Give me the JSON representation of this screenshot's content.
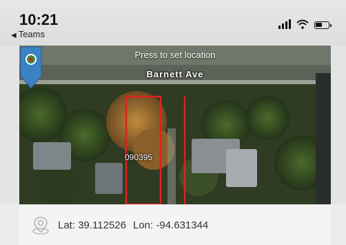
{
  "status_bar": {
    "time": "10:21",
    "back_label": "Teams",
    "icons": [
      "signal-icon",
      "wifi-icon",
      "battery-icon"
    ]
  },
  "map": {
    "hint": "Press to set location",
    "street_name": "Barnett Ave",
    "parcel_id": "090395",
    "pin_color": "#3b82c4",
    "parcel_border_color": "#e02020"
  },
  "coordinates": {
    "lat_label": "Lat:",
    "lat_value": "39.112526",
    "lon_label": "Lon:",
    "lon_value": "-94.631344"
  }
}
